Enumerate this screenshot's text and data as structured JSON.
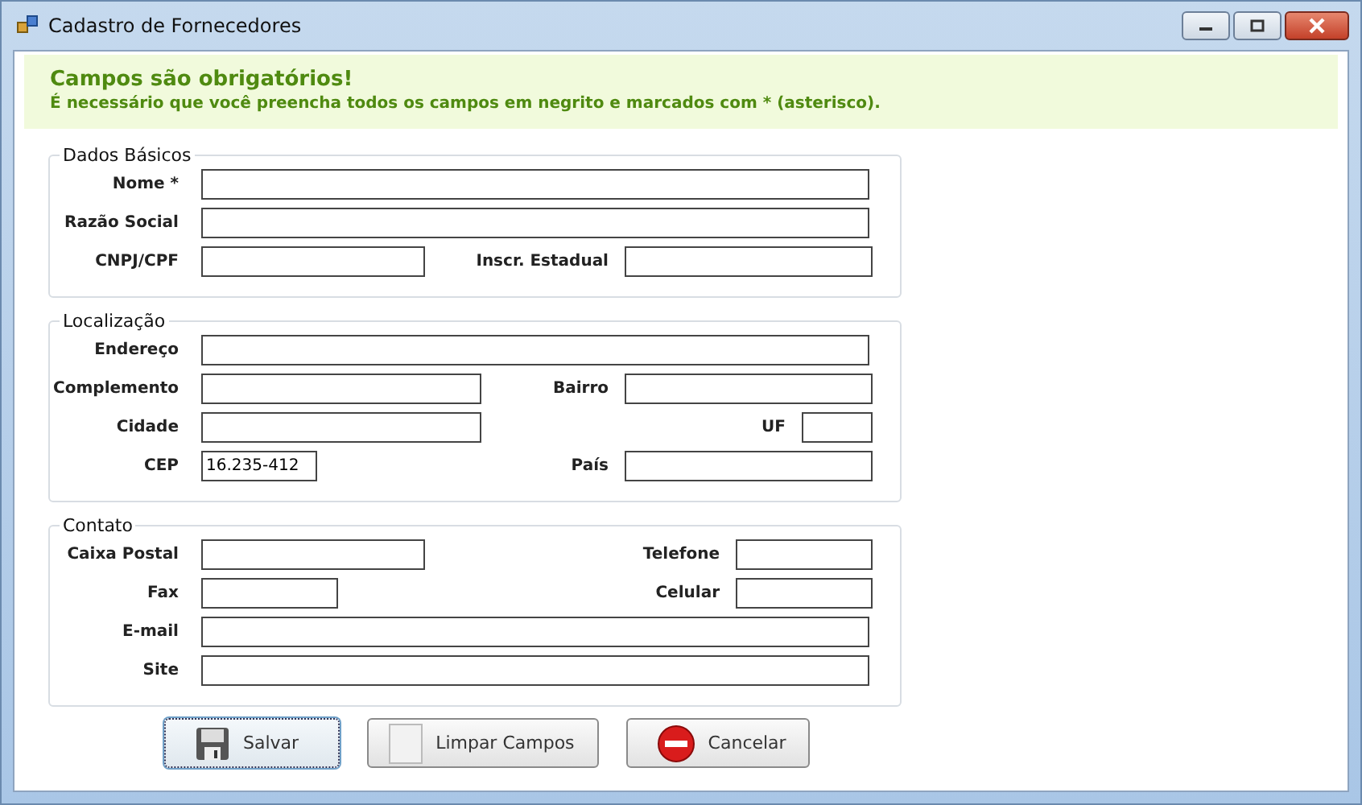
{
  "window": {
    "title": "Cadastro de Fornecedores"
  },
  "notice": {
    "title": "Campos são obrigatórios!",
    "text": "É necessário que você preencha todos os campos em negrito e marcados com * (asterisco)."
  },
  "groups": [
    {
      "title": "Dados Básicos",
      "rows": [
        [
          {
            "label": "Nome *"
          }
        ],
        [
          {
            "label": "Razão Social"
          }
        ],
        [
          {
            "label": "CNPJ/CPF"
          },
          {
            "label": "Inscr. Estadual"
          }
        ]
      ]
    },
    {
      "title": "Localização",
      "rows": [
        [
          {
            "label": "Endereço"
          }
        ],
        [
          {
            "label": "Complemento"
          },
          {
            "label": "Bairro"
          }
        ],
        [
          {
            "label": "Cidade"
          },
          {
            "label": "UF"
          }
        ],
        [
          {
            "label": "CEP",
            "value": "16.235-412"
          },
          {
            "label": "País"
          }
        ]
      ]
    },
    {
      "title": "Contato",
      "rows": [
        [
          {
            "label": "Caixa Postal"
          },
          {
            "label": "Telefone"
          }
        ],
        [
          {
            "label": "Fax"
          },
          {
            "label": "Celular"
          }
        ],
        [
          {
            "label": "E-mail"
          }
        ],
        [
          {
            "label": "Site"
          }
        ]
      ]
    }
  ],
  "buttons": [
    {
      "label": "Salvar",
      "kind": "save",
      "focused": true
    },
    {
      "label": "Limpar Campos",
      "kind": "clear",
      "focused": false
    },
    {
      "label": "Cancelar",
      "kind": "cancel",
      "focused": false
    }
  ]
}
